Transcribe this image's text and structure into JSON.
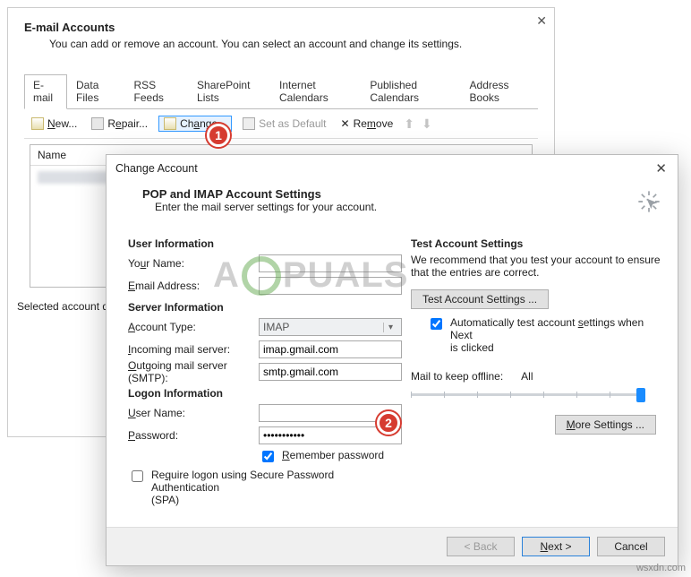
{
  "back": {
    "heading": "E-mail Accounts",
    "sub": "You can add or remove an account. You can select an account and change its settings.",
    "tabs": [
      "E-mail",
      "Data Files",
      "RSS Feeds",
      "SharePoint Lists",
      "Internet Calendars",
      "Published Calendars",
      "Address Books"
    ],
    "tools": {
      "new": "New...",
      "repair": "Repair...",
      "change": "Change...",
      "default": "Set as Default",
      "remove": "Remove"
    },
    "list_header": "Name",
    "status": "Selected account de"
  },
  "front": {
    "title": "Change Account",
    "head1": "POP and IMAP Account Settings",
    "head2": "Enter the mail server settings for your account.",
    "sections": {
      "user": "User Information",
      "server": "Server Information",
      "logon": "Logon Information",
      "test": "Test Account Settings"
    },
    "labels": {
      "your_name": "Your Name:",
      "email": "Email Address:",
      "acct_type": "Account Type:",
      "incoming": "Incoming mail server:",
      "outgoing": "Outgoing mail server (SMTP):",
      "user": "User Name:",
      "pass": "Password:"
    },
    "values": {
      "acct_type": "IMAP",
      "incoming": "imap.gmail.com",
      "outgoing": "smtp.gmail.com",
      "pass": "***********"
    },
    "remember": "Remember password",
    "spa": "Require logon using Secure Password Authentication (SPA)",
    "test_desc": "We recommend that you test your account to ensure that the entries are correct.",
    "test_btn": "Test Account Settings ...",
    "auto_test": "Automatically test account settings when Next is clicked",
    "offline_label": "Mail to keep offline:",
    "offline_value": "All",
    "more": "More Settings ...",
    "buttons": {
      "back": "< Back",
      "next": "Next >",
      "cancel": "Cancel"
    }
  },
  "badges": {
    "one": "1",
    "two": "2"
  },
  "watermark": "A   PUALS",
  "attribution": "wsxdn.com"
}
